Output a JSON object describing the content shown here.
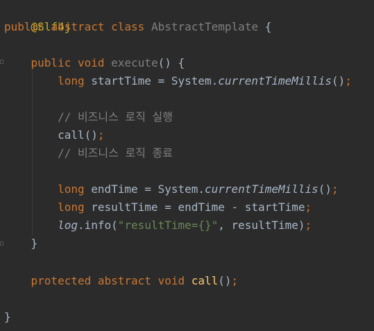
{
  "editor": {
    "annotation": "@Slf4j",
    "class_decl": {
      "kw_public": "public",
      "kw_abstract": "abstract",
      "kw_class": "class",
      "class_name": "AbstractTemplate",
      "open_brace": "{"
    },
    "execute_decl": {
      "kw_public": "public",
      "kw_void": "void",
      "method_name": "execute",
      "parens": "()",
      "open_brace": "{"
    },
    "line_start_time": {
      "type": "long",
      "text": "startTime = System.",
      "call": "currentTimeMillis",
      "tail": "()",
      "semi": ";"
    },
    "comment_start": "// 비즈니스 로직 실행",
    "line_call": {
      "name": "call",
      "tail": "()",
      "semi": ";"
    },
    "comment_end": "// 비즈니스 로직 종료",
    "line_end_time": {
      "type": "long",
      "text": "endTime = System.",
      "call": "currentTimeMillis",
      "tail": "()",
      "semi": ";"
    },
    "line_result_time": {
      "type": "long",
      "text": "resultTime = endTime - startTime",
      "semi": ";"
    },
    "line_log": {
      "obj": "log",
      "method": ".info(",
      "string": "\"resultTime={}\"",
      "rest": ", resultTime)",
      "semi": ";"
    },
    "close_method": "}",
    "call_decl": {
      "kw_protected": "protected",
      "kw_abstract": "abstract",
      "kw_void": "void",
      "method_name": "call",
      "tail": "()",
      "semi": ";"
    },
    "close_class": "}"
  }
}
